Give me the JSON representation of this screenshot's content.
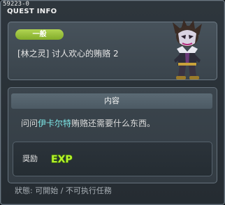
{
  "window": {
    "quest_id": "59223-0",
    "title": "QUEST INFO"
  },
  "quest": {
    "category": "一般",
    "name": "[林之灵] 讨人欢心的贿赂 2",
    "npc_portrait": "masked-npc-portrait"
  },
  "content": {
    "header": "内容",
    "desc_prefix": "问问",
    "desc_npc": "伊卡尔特",
    "desc_suffix": "贿赂还需要什么东西。"
  },
  "reward": {
    "label": "奨励",
    "icon": "exp-icon",
    "icon_text": "EXP"
  },
  "status": {
    "text": "狀態: 可開始 / 不可执行任務"
  },
  "colors": {
    "badge": "#98c03a",
    "npc_highlight": "#7de6e6",
    "exp": "#b6f22a"
  }
}
